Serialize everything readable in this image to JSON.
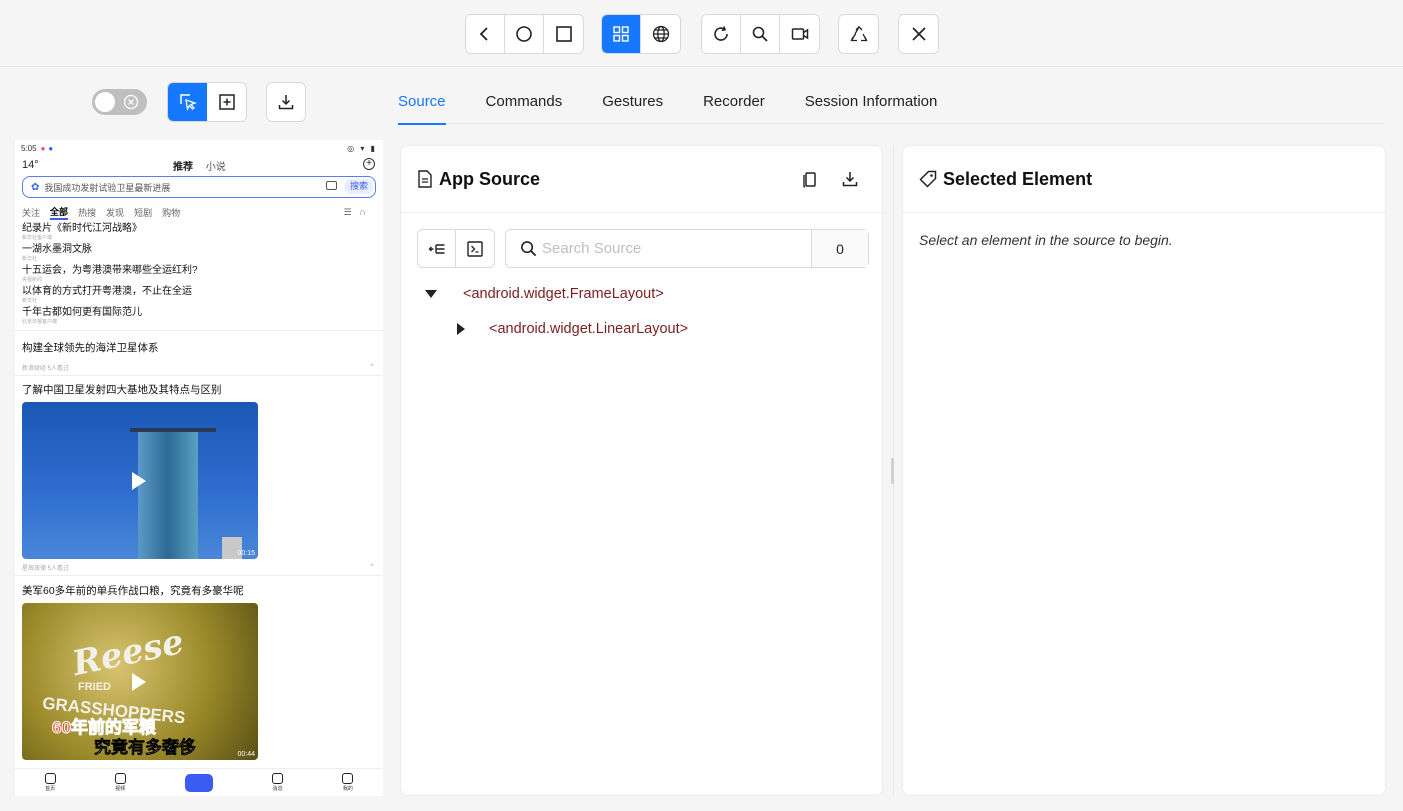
{
  "toolbar": {
    "groups": [
      [
        "back",
        "home",
        "app-switch"
      ],
      [
        "native-mode",
        "web-mode"
      ],
      [
        "refresh",
        "search",
        "record"
      ],
      [
        "recycle"
      ],
      [
        "close"
      ]
    ]
  },
  "tabs": [
    {
      "label": "Source",
      "active": true
    },
    {
      "label": "Commands",
      "active": false
    },
    {
      "label": "Gestures",
      "active": false
    },
    {
      "label": "Recorder",
      "active": false
    },
    {
      "label": "Session Information",
      "active": false
    }
  ],
  "app_source": {
    "title": "App Source",
    "search_placeholder": "Search Source",
    "match_count": "0",
    "tree": [
      {
        "label": "<android.widget.FrameLayout>",
        "expanded": true,
        "depth": 0
      },
      {
        "label": "<android.widget.LinearLayout>",
        "expanded": false,
        "depth": 1
      }
    ]
  },
  "selected_element": {
    "title": "Selected Element",
    "empty_message": "Select an element in the source to begin."
  },
  "device": {
    "status_time": "5:05",
    "temperature": "14°",
    "top_tabs": [
      "推荐",
      "小说"
    ],
    "search_text": "我国成功发射试验卫星最新进展",
    "search_button": "搜索",
    "categories": [
      "关注",
      "全部",
      "热搜",
      "发现",
      "短剧",
      "购物"
    ],
    "hot_list": [
      {
        "title": "纪录片《新时代江河战略》",
        "source": "新华社客户端"
      },
      {
        "title": "一湖水墨洞文脉",
        "source": "新华社"
      },
      {
        "title": "十五运会，为粤港澳带来哪些全运红利?",
        "source": "央视新闻"
      },
      {
        "title": "以体育的方式打开粤港澳，不止在全运",
        "source": "新华社"
      },
      {
        "title": "千年古都如何更有国际范儿",
        "source": "北京日报客户端"
      }
    ],
    "news": [
      {
        "title": "构建全球领先的海洋卫星体系",
        "meta": "新浪财经  5人看过"
      },
      {
        "title": "了解中国卫星发射四大基地及其特点与区别",
        "duration": "00:15",
        "meta": "星辰旅律  5人看过"
      },
      {
        "title": "美军60多年前的单兵作战口粮，究竟有多豪华呢",
        "duration": "00:44",
        "video_text": {
          "brand": "Reese",
          "fried": "FRIED",
          "product": "GRASSHOPPERS",
          "caption1": "60年前的军粮",
          "caption2": "究竟有多奢侈"
        }
      }
    ],
    "nav": [
      "首页",
      "视频",
      "",
      "消息",
      "我的"
    ]
  },
  "colors": {
    "accent": "#1677ff",
    "tree_tag": "#7a1f1f"
  }
}
